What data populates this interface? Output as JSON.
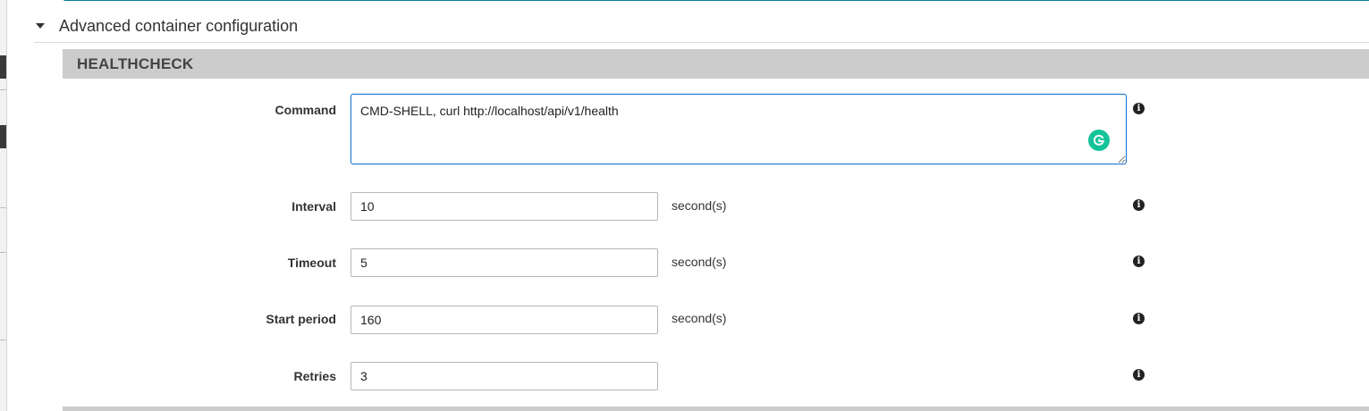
{
  "section": {
    "title": "Advanced container configuration"
  },
  "healthcheck": {
    "title": "HEALTHCHECK",
    "command": {
      "label": "Command",
      "value": "CMD-SHELL, curl http://localhost/api/v1/health"
    },
    "interval": {
      "label": "Interval",
      "value": "10",
      "unit": "second(s)"
    },
    "timeout": {
      "label": "Timeout",
      "value": "5",
      "unit": "second(s)"
    },
    "start_period": {
      "label": "Start period",
      "value": "160",
      "unit": "second(s)"
    },
    "retries": {
      "label": "Retries",
      "value": "3"
    }
  },
  "icons": {
    "info": "info-icon",
    "grammarly": "grammarly-icon",
    "caret": "caret-down-icon"
  },
  "colors": {
    "header_bg": "#cccccc",
    "focus_border": "#1f77d0",
    "grammarly": "#15c39a"
  }
}
